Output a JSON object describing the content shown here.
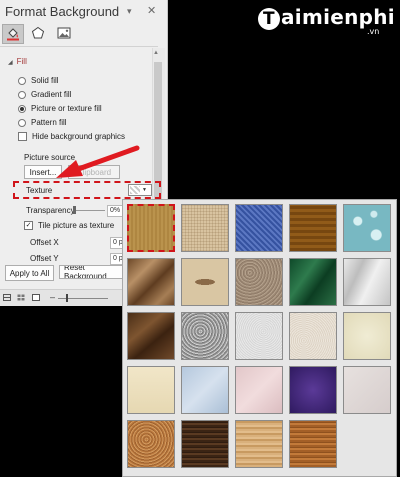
{
  "pane": {
    "title": "Format Background",
    "dropdown_glyph": "▾",
    "close_glyph": "✕",
    "fill_section": "Fill",
    "options": {
      "solid": "Solid fill",
      "gradient": "Gradient fill",
      "picture": "Picture or texture fill",
      "pattern": "Pattern fill",
      "hide_graphics": "Hide background graphics"
    },
    "picture_source": "Picture source",
    "insert_button": "Insert...",
    "clipboard_button": "Clipboard",
    "texture_label": "Texture",
    "transparency_label": "Transparency",
    "transparency_value": "0%",
    "tile_label": "Tile picture as texture",
    "offset_x_label": "Offset X",
    "offset_x_value": "0 pt",
    "offset_y_label": "Offset Y",
    "offset_y_value": "0 pt",
    "apply_all_button": "Apply to All",
    "reset_button": "Reset Background"
  },
  "logo": {
    "brand": "Taimienphi",
    "suffix": ".vn"
  },
  "icons": [
    "paint-bucket-icon",
    "pentagon-icon",
    "picture-icon",
    "close-icon",
    "dropdown-arrow-icon"
  ],
  "colors": {
    "annotation_red": "#d0141a",
    "pane_bg": "#eeeeee",
    "fill_header": "#a43a3a"
  },
  "textures": [
    "Papyrus",
    "Canvas",
    "Denim",
    "Woven mat",
    "Water droplets",
    "Paper bag",
    "Fish fossil",
    "Sand",
    "Green marble",
    "White marble",
    "Brown marble",
    "Granite",
    "Newsprint",
    "Recycled paper",
    "Parchment",
    "Stationery",
    "Blue tissue paper",
    "Pink tissue paper",
    "Purple mesh",
    "Bouquet",
    "Cork",
    "Walnut",
    "Oak",
    "Medium wood"
  ]
}
